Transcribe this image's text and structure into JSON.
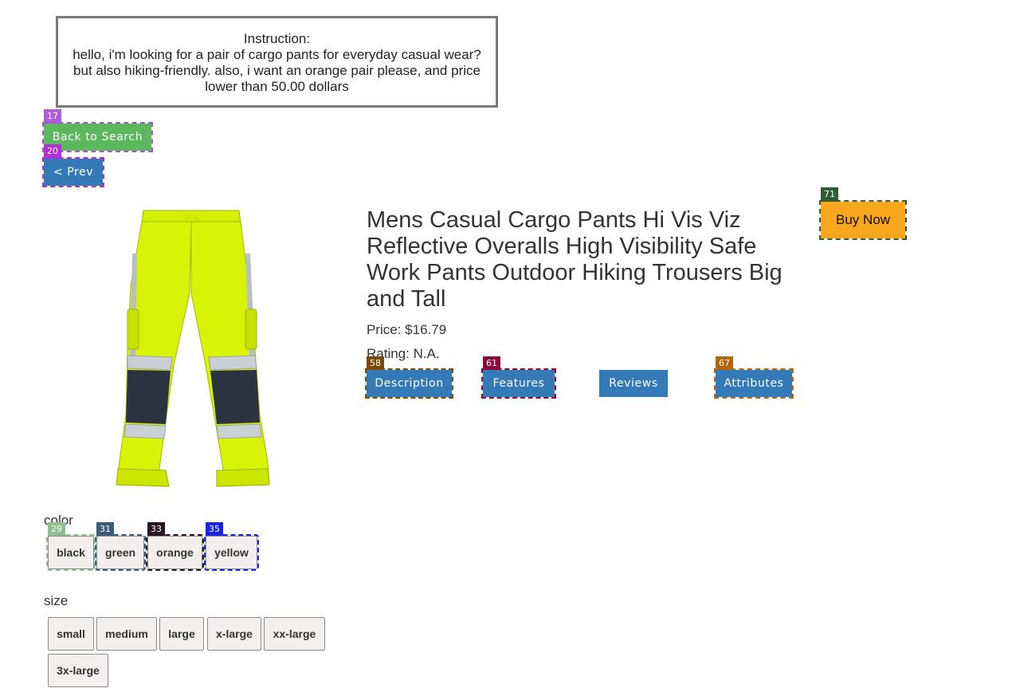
{
  "instruction": {
    "heading": "Instruction:",
    "text": "hello, i'm looking for a pair of cargo pants for everyday casual wear? but also hiking-friendly. also, i want an orange pair please, and price lower than 50.00 dollars"
  },
  "nav": {
    "back_label": "Back to Search",
    "back_tag": "17",
    "prev_label": "< Prev",
    "prev_tag": "20"
  },
  "product": {
    "title": "Mens Casual Cargo Pants Hi Vis Viz Reflective Overalls High Visibility Safe Work Pants Outdoor Hiking Trousers Big and Tall",
    "price": "Price: $16.79",
    "rating": "Rating: N.A."
  },
  "tabs": [
    {
      "label": "Description",
      "tag": "58"
    },
    {
      "label": "Features",
      "tag": "61"
    },
    {
      "label": "Reviews",
      "tag": ""
    },
    {
      "label": "Attributes",
      "tag": "67"
    }
  ],
  "buy": {
    "label": "Buy Now",
    "tag": "71"
  },
  "color": {
    "label": "color",
    "options": [
      {
        "label": "black",
        "tag": "29"
      },
      {
        "label": "green",
        "tag": "31"
      },
      {
        "label": "orange",
        "tag": "33"
      },
      {
        "label": "yellow",
        "tag": "35"
      }
    ]
  },
  "size": {
    "label": "size",
    "options": [
      "small",
      "medium",
      "large",
      "x-large",
      "xx-large",
      "3x-large"
    ]
  },
  "colors": {
    "green_button": "#5cb85c",
    "blue_button": "#337ab7",
    "buy_button": "#f8a61c",
    "product_neon": "#d4f000"
  },
  "image": {
    "icon": "product-photo-hi-vis-pants"
  }
}
